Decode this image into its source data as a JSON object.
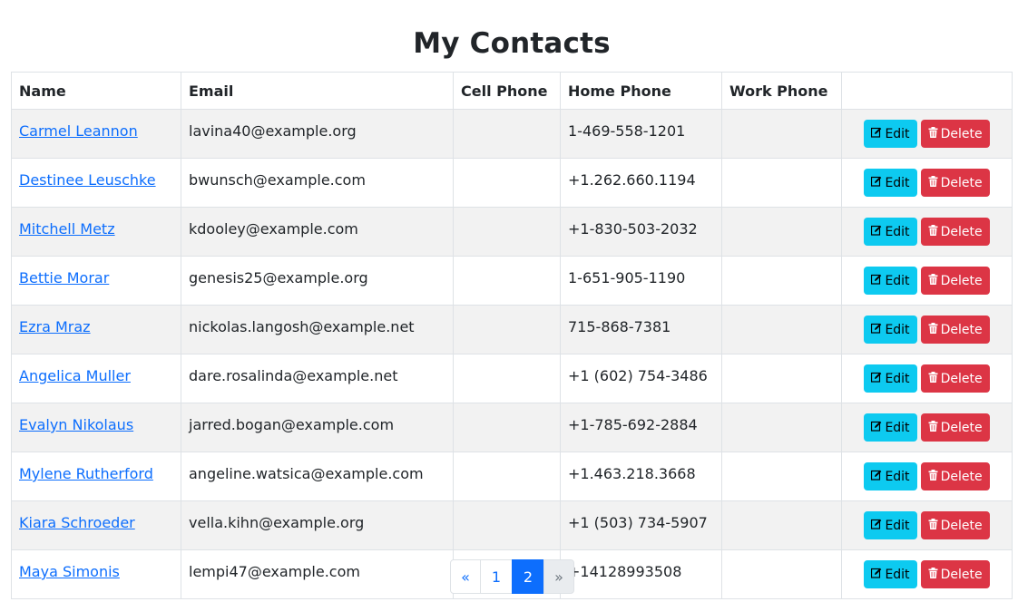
{
  "page": {
    "title": "My Contacts"
  },
  "table": {
    "headers": {
      "name": "Name",
      "email": "Email",
      "cell": "Cell Phone",
      "home": "Home Phone",
      "work": "Work Phone",
      "actions": ""
    },
    "rows": [
      {
        "name": "Carmel Leannon",
        "email": "lavina40@example.org",
        "cell": "",
        "home": "1-469-558-1201",
        "work": ""
      },
      {
        "name": "Destinee Leuschke",
        "email": "bwunsch@example.com",
        "cell": "",
        "home": "+1.262.660.1194",
        "work": ""
      },
      {
        "name": "Mitchell Metz",
        "email": "kdooley@example.com",
        "cell": "",
        "home": "+1-830-503-2032",
        "work": ""
      },
      {
        "name": "Bettie Morar",
        "email": "genesis25@example.org",
        "cell": "",
        "home": "1-651-905-1190",
        "work": ""
      },
      {
        "name": "Ezra Mraz",
        "email": "nickolas.langosh@example.net",
        "cell": "",
        "home": "715-868-7381",
        "work": ""
      },
      {
        "name": "Angelica Muller",
        "email": "dare.rosalinda@example.net",
        "cell": "",
        "home": "+1 (602) 754-3486",
        "work": ""
      },
      {
        "name": "Evalyn Nikolaus",
        "email": "jarred.bogan@example.com",
        "cell": "",
        "home": "+1-785-692-2884",
        "work": ""
      },
      {
        "name": "Mylene Rutherford",
        "email": "angeline.watsica@example.com",
        "cell": "",
        "home": "+1.463.218.3668",
        "work": ""
      },
      {
        "name": "Kiara Schroeder",
        "email": "vella.kihn@example.org",
        "cell": "",
        "home": "+1 (503) 734-5907",
        "work": ""
      },
      {
        "name": "Maya Simonis",
        "email": "lempi47@example.com",
        "cell": "",
        "home": "+14128993508",
        "work": ""
      }
    ],
    "edit_label": "Edit",
    "delete_label": "Delete",
    "edit_icon": "edit-icon",
    "delete_icon": "trash-icon"
  },
  "pagination": {
    "prev": "«",
    "pages": [
      "1",
      "2"
    ],
    "active": "2",
    "next": "»"
  },
  "colors": {
    "link": "#0d6efd",
    "edit_button": "#0dcaf0",
    "delete_button": "#dc3545",
    "active_page": "#0d6efd",
    "striped_row": "#f2f2f2"
  }
}
